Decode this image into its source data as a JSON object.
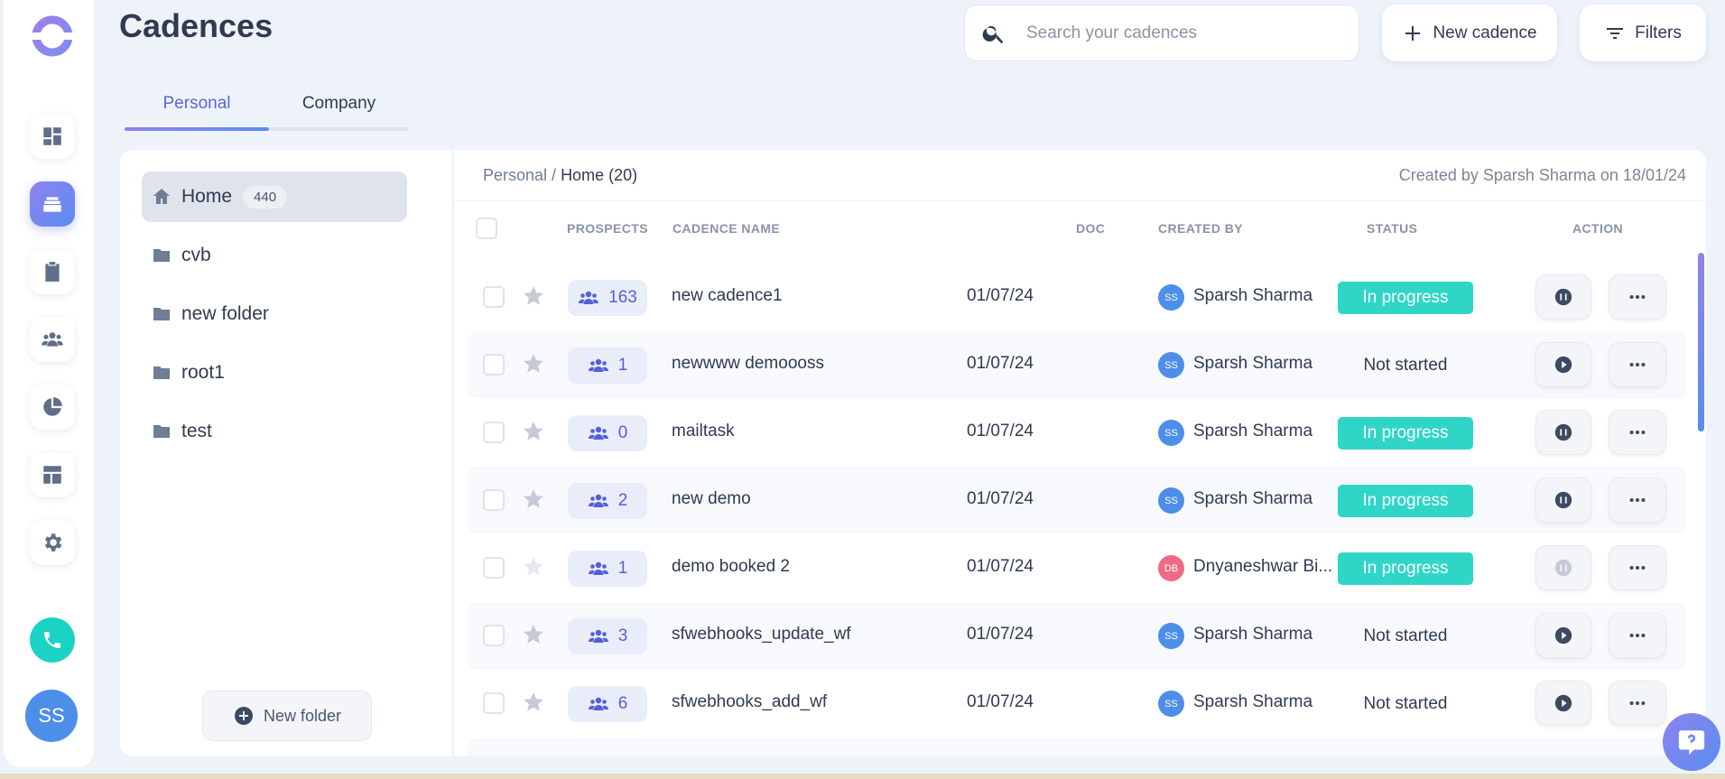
{
  "app": {
    "title": "Cadences"
  },
  "colors": {
    "accent": "#5a8cf0",
    "accent2": "#8f83ef",
    "status_in_progress": "#2fd6c8",
    "page_bg": "#eef3fa"
  },
  "sidebar": {
    "icons": [
      "dashboard-icon",
      "cadences-icon",
      "tasks-icon",
      "people-icon",
      "reports-icon",
      "templates-icon",
      "settings-icon"
    ],
    "active": "cadences-icon",
    "user_initials": "SS"
  },
  "header": {
    "search_placeholder": "Search your cadences",
    "new_cadence_label": "New cadence",
    "filters_label": "Filters"
  },
  "tabs": [
    {
      "label": "Personal",
      "active": true
    },
    {
      "label": "Company",
      "active": false
    }
  ],
  "folders": {
    "items": [
      {
        "label": "Home",
        "count": "440",
        "icon": "home-icon",
        "active": true
      },
      {
        "label": "cvb",
        "icon": "folder-icon"
      },
      {
        "label": "new folder",
        "icon": "folder-icon"
      },
      {
        "label": "root1",
        "icon": "folder-icon"
      },
      {
        "label": "test",
        "icon": "folder-icon"
      }
    ],
    "new_folder_label": "New folder"
  },
  "table": {
    "breadcrumb_root": "Personal",
    "breadcrumb_sep": " / ",
    "breadcrumb_current": "Home (20)",
    "created_note": "Created by Sparsh Sharma on 18/01/24",
    "columns": {
      "prospects": "PROSPECTS",
      "cadence_name": "CADENCE NAME",
      "doc": "DOC",
      "created_by": "CREATED BY",
      "status": "STATUS",
      "action": "ACTION"
    },
    "rows": [
      {
        "prospects": "163",
        "name": "new cadence1",
        "doc": "01/07/24",
        "initials": "SS",
        "creator": "Sparsh Sharma",
        "status": "In progress",
        "action": "pause"
      },
      {
        "prospects": "1",
        "name": "newwww demoooss",
        "doc": "01/07/24",
        "initials": "SS",
        "creator": "Sparsh Sharma",
        "status": "Not started",
        "action": "play"
      },
      {
        "prospects": "0",
        "name": "mailtask",
        "doc": "01/07/24",
        "initials": "SS",
        "creator": "Sparsh Sharma",
        "status": "In progress",
        "action": "pause"
      },
      {
        "prospects": "2",
        "name": "new demo",
        "doc": "01/07/24",
        "initials": "SS",
        "creator": "Sparsh Sharma",
        "status": "In progress",
        "action": "pause"
      },
      {
        "prospects": "1",
        "name": "demo booked 2",
        "doc": "01/07/24",
        "initials": "DB",
        "creator": "Dnyaneshwar Bi...",
        "status": "In progress",
        "action": "pause-disabled"
      },
      {
        "prospects": "3",
        "name": "sfwebhooks_update_wf",
        "doc": "01/07/24",
        "initials": "SS",
        "creator": "Sparsh Sharma",
        "status": "Not started",
        "action": "play"
      },
      {
        "prospects": "6",
        "name": "sfwebhooks_add_wf",
        "doc": "01/07/24",
        "initials": "SS",
        "creator": "Sparsh Sharma",
        "status": "Not started",
        "action": "play"
      }
    ]
  }
}
